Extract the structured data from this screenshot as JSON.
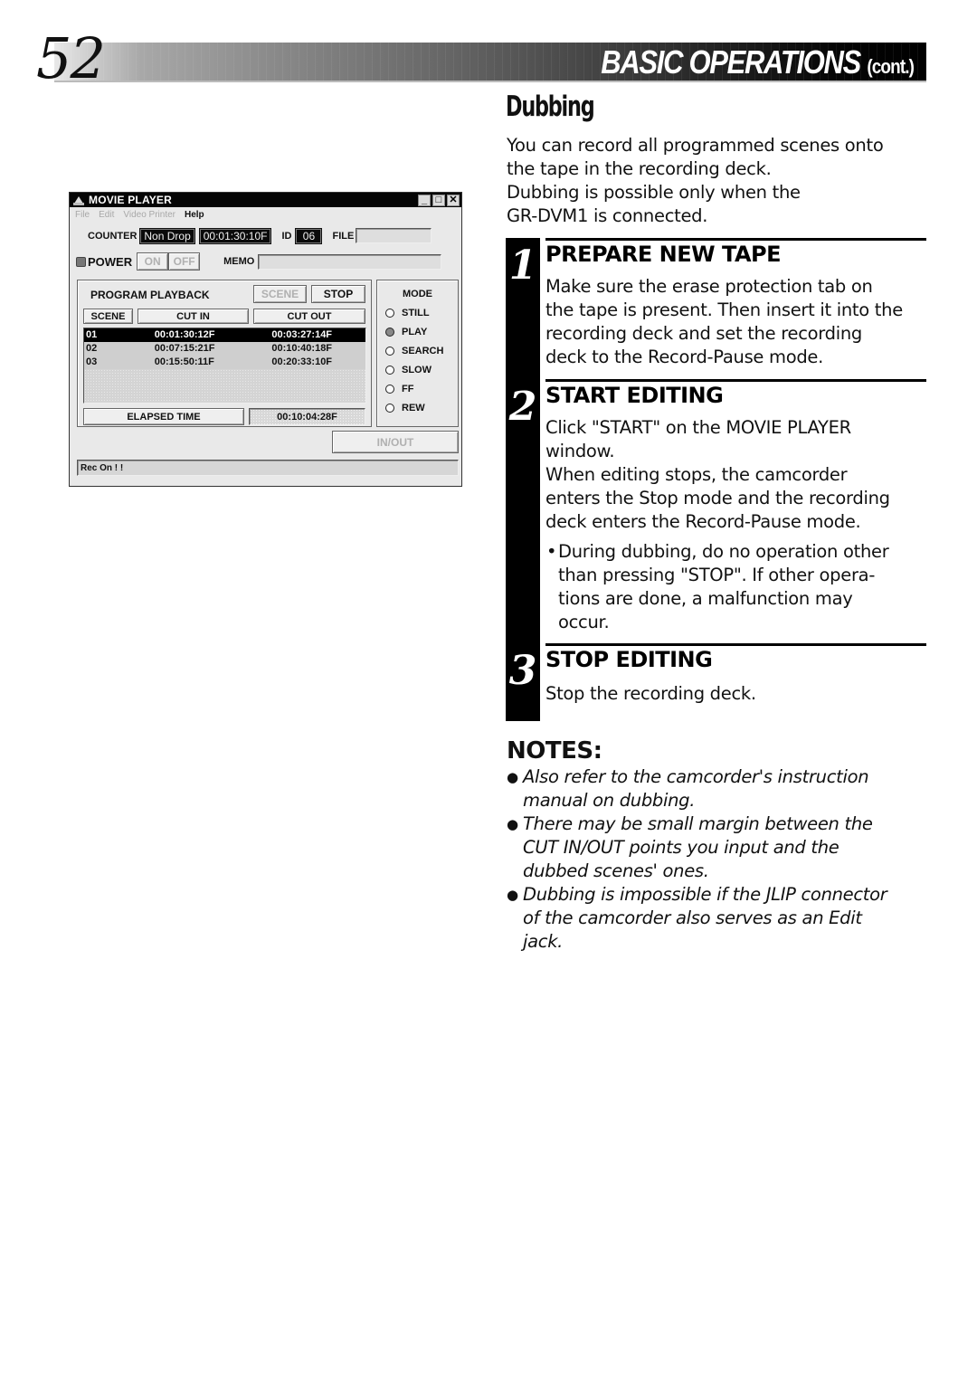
{
  "header": {
    "page_number": "52",
    "title": "BASIC OPERATIONS",
    "title_suffix": "(cont.)"
  },
  "movie_player": {
    "window_title": "MOVIE PLAYER",
    "window_controls": {
      "minimize": "_",
      "maximize": "□",
      "close": "✕"
    },
    "menu": [
      {
        "label": "File",
        "enabled": false
      },
      {
        "label": "Edit",
        "enabled": false
      },
      {
        "label": "Video Printer",
        "enabled": false
      },
      {
        "label": "Help",
        "enabled": true
      }
    ],
    "counter_label": "COUNTER",
    "counter_mode": "Non Drop",
    "counter_value": "00:01:30:10F",
    "id_label": "ID",
    "id_value": "06",
    "file_label": "FILE",
    "file_value": "",
    "power_label": "POWER",
    "power_on": "ON",
    "power_off": "OFF",
    "memo_label": "MEMO",
    "memo_value": "",
    "program_playback": {
      "title": "PROGRAM PLAYBACK",
      "scene_button": "SCENE",
      "stop_button": "STOP",
      "columns": [
        "SCENE",
        "CUT IN",
        "CUT OUT"
      ],
      "rows": [
        {
          "scene": "01",
          "cut_in": "00:01:30:12F",
          "cut_out": "00:03:27:14F",
          "selected": true
        },
        {
          "scene": "02",
          "cut_in": "00:07:15:21F",
          "cut_out": "00:10:40:18F",
          "selected": false
        },
        {
          "scene": "03",
          "cut_in": "00:15:50:11F",
          "cut_out": "00:20:33:10F",
          "selected": false
        }
      ],
      "elapsed_label": "ELAPSED TIME",
      "elapsed_value": "00:10:04:28F"
    },
    "mode": {
      "title": "MODE",
      "options": [
        "STILL",
        "PLAY",
        "SEARCH",
        "SLOW",
        "FF",
        "REW"
      ],
      "selected": "PLAY"
    },
    "inout_button": "IN/OUT",
    "status": "Rec On ! !"
  },
  "content": {
    "section_title": "Dubbing",
    "intro": [
      "You can record all programmed scenes onto",
      "the tape in the recording deck.",
      "Dubbing is possible only when the",
      "GR-DVM1 is connected."
    ],
    "steps": [
      {
        "number": "1",
        "heading": "PREPARE NEW TAPE",
        "body": [
          "Make sure the erase protection tab on",
          "the tape is present. Then insert it into the",
          "recording deck and set the recording",
          "deck to the Record-Pause mode."
        ]
      },
      {
        "number": "2",
        "heading": "START EDITING",
        "body": [
          "Click \"START\" on the MOVIE PLAYER",
          "window.",
          "When editing stops, the camcorder",
          "enters the Stop mode and the recording",
          "deck enters the Record-Pause mode."
        ],
        "bullet": [
          "During dubbing, do no operation other",
          "than pressing \"STOP\". If other opera-",
          "tions are done, a malfunction may",
          "occur."
        ]
      },
      {
        "number": "3",
        "heading": "STOP EDITING",
        "body": [
          "Stop the recording deck."
        ]
      }
    ],
    "notes_heading": "NOTES:",
    "notes": [
      [
        "Also refer to the camcorder's instruction",
        "manual on dubbing."
      ],
      [
        "There may be small margin between the",
        "CUT IN/OUT points you input and the",
        "dubbed scenes' ones."
      ],
      [
        "Dubbing is impossible if the JLIP connector",
        "of the camcorder also serves as an Edit",
        "jack."
      ]
    ]
  }
}
